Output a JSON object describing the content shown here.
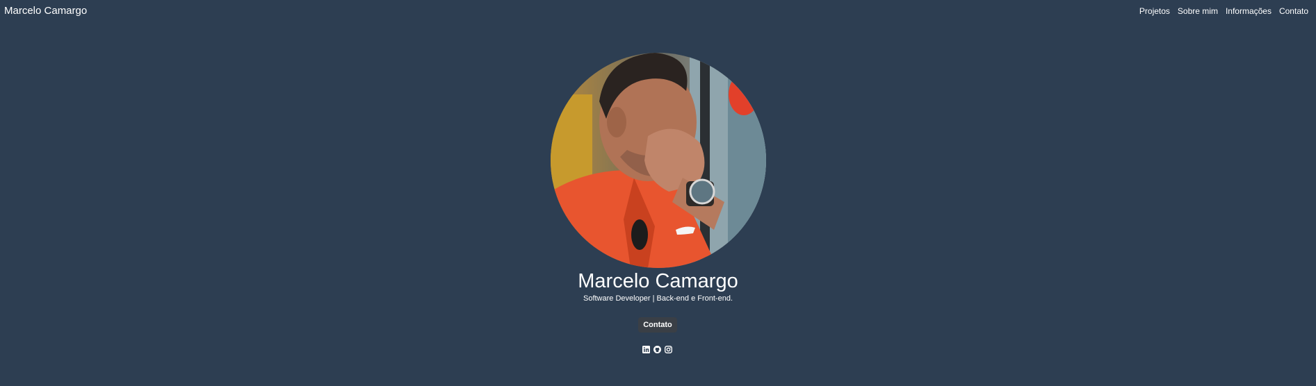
{
  "navbar": {
    "brand": "Marcelo Camargo",
    "links": [
      {
        "label": "Projetos"
      },
      {
        "label": "Sobre mim"
      },
      {
        "label": "Informações"
      },
      {
        "label": "Contato"
      }
    ]
  },
  "hero": {
    "name": "Marcelo Camargo",
    "tagline": "Software Developer | Back-end e Front-end.",
    "contact_button": "Contato",
    "avatar_alt": "profile photo"
  },
  "socials": [
    {
      "icon": "linkedin-icon"
    },
    {
      "icon": "github-icon"
    },
    {
      "icon": "instagram-icon"
    }
  ],
  "colors": {
    "background": "#2d3e52",
    "button": "#3a3f46",
    "text": "#ffffff"
  }
}
